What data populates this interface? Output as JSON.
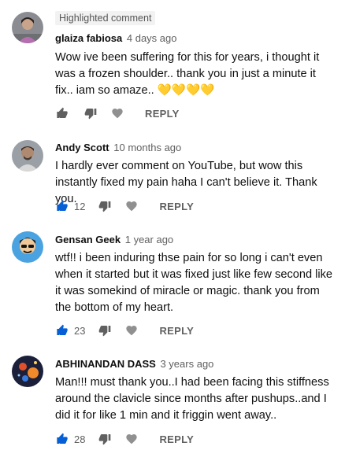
{
  "colors": {
    "like_active": "#065fd4",
    "icon_gray": "#606060",
    "badge_bg": "#f2f2f2"
  },
  "comments": [
    {
      "badge": "Highlighted comment",
      "author": "glaiza fabiosa",
      "time": "4 days ago",
      "text": "Wow ive been suffering for this for years, i thought it was a frozen shoulder.. thank you in just a minute it fix.. iam so amaze.. 💛💛💛💛",
      "likes": "",
      "like_icon": "thumb-up-outline",
      "reply_label": "REPLY"
    },
    {
      "author": "Andy Scott",
      "time": "10 months ago",
      "text": "I hardly ever comment on YouTube, but wow this instantly fixed my pain haha I can't believe it. Thank you.",
      "likes": "12",
      "like_icon": "thumb-up-filled",
      "reply_label": "REPLY"
    },
    {
      "author": "Gensan Geek",
      "time": "1 year ago",
      "text": "wtf!! i been induring thse pain for so long i can't even when it started but it was fixed just like few second like it was somekind of miracle or magic. thank you from the bottom of my heart.",
      "likes": "23",
      "like_icon": "thumb-up-filled",
      "reply_label": "REPLY"
    },
    {
      "author": "ABHINANDAN DASS",
      "time": "3 years ago",
      "text": "Man!!! must thank you..I had been facing this stiffness around the clavicle since months after pushups..and I did it for like 1 min and it friggin went away..",
      "likes": "28",
      "like_icon": "thumb-up-filled",
      "reply_label": "REPLY"
    }
  ]
}
